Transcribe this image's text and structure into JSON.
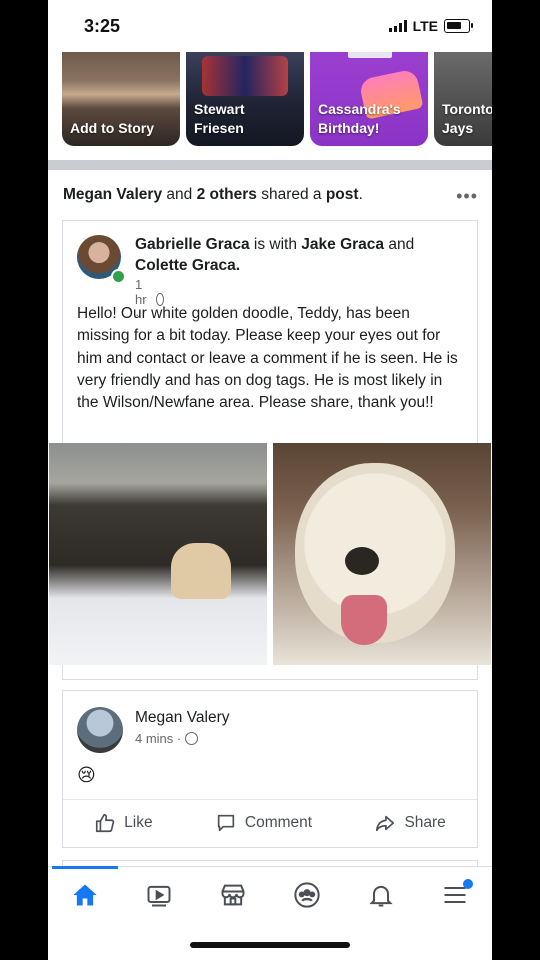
{
  "status_bar": {
    "time": "3:25",
    "network": "LTE"
  },
  "stories": [
    {
      "label": "Add to Story"
    },
    {
      "label": "Stewart Friesen"
    },
    {
      "label": "Cassandra's Birthday!"
    },
    {
      "label": "Toronto Jays"
    }
  ],
  "shared_header": {
    "name": "Megan Valery",
    "and": "and",
    "others": "2 others",
    "shared": "shared a",
    "post": "post",
    "period": "."
  },
  "post": {
    "author": "Gabrielle Graca",
    "is_with": "is with",
    "with_1": "Jake Graca",
    "and": "and",
    "with_2": "Colette Graca.",
    "time": "1 hr ·",
    "text": "Hello! Our white golden doodle, Teddy, has been missing for a bit today. Please keep your eyes out for him and contact or leave a comment if he is seen. He is very friendly and has on dog tags. He is most likely in the Wilson/Newfane area. Please share, thank you!!"
  },
  "comment": {
    "author": "Megan Valery",
    "time": "4 mins ·",
    "emoji": "😢"
  },
  "actions": {
    "like": "Like",
    "comment": "Comment",
    "share": "Share"
  },
  "colors": {
    "accent": "#1877f2",
    "online": "#31a24c",
    "divider": "#c9ccd1"
  }
}
